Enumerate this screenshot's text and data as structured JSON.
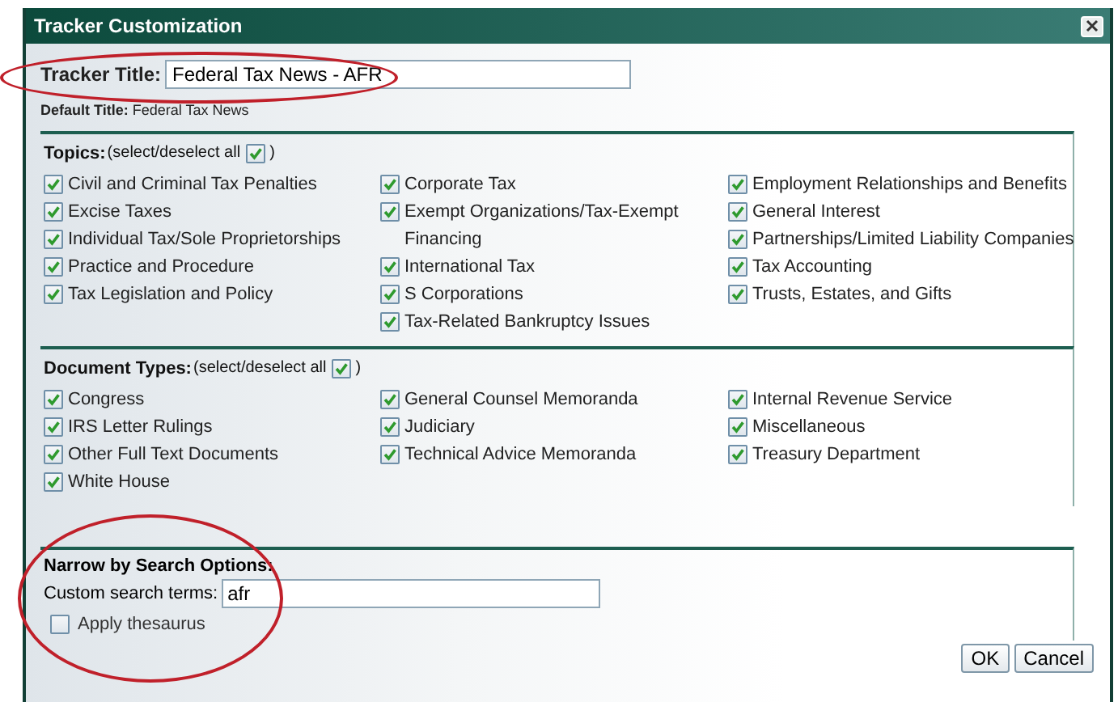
{
  "window": {
    "title": "Tracker Customization"
  },
  "tracker_title": {
    "label": "Tracker Title:",
    "value": "Federal Tax News - AFR",
    "highlighted": true
  },
  "default_title": {
    "label": "Default Title:",
    "value": "Federal Tax News"
  },
  "topics": {
    "label": "Topics:",
    "select_all_label": "(select/deselect all",
    "select_all_end": ")",
    "select_all_checked": true,
    "columns": [
      [
        {
          "label": "Civil and Criminal Tax Penalties",
          "checked": true
        },
        {
          "label": "Excise Taxes",
          "checked": true
        },
        {
          "label": "Individual Tax/Sole Proprietorships",
          "checked": true
        },
        {
          "label": "Practice and Procedure",
          "checked": true
        },
        {
          "label": "Tax Legislation and Policy",
          "checked": true
        }
      ],
      [
        {
          "label": "Corporate Tax",
          "checked": true
        },
        {
          "label": "Exempt Organizations/Tax-Exempt Financing",
          "checked": true
        },
        {
          "label": "International Tax",
          "checked": true
        },
        {
          "label": "S Corporations",
          "checked": true
        },
        {
          "label": "Tax-Related Bankruptcy Issues",
          "checked": true
        }
      ],
      [
        {
          "label": "Employment Relationships and Benefits",
          "checked": true
        },
        {
          "label": "General Interest",
          "checked": true
        },
        {
          "label": "Partnerships/Limited Liability Companies",
          "checked": true
        },
        {
          "label": "Tax Accounting",
          "checked": true
        },
        {
          "label": "Trusts, Estates, and Gifts",
          "checked": true
        }
      ]
    ]
  },
  "document_types": {
    "label": "Document Types:",
    "select_all_label": "(select/deselect all",
    "select_all_end": ")",
    "select_all_checked": true,
    "columns": [
      [
        {
          "label": "Congress",
          "checked": true
        },
        {
          "label": "IRS Letter Rulings",
          "checked": true
        },
        {
          "label": "Other Full Text Documents",
          "checked": true
        },
        {
          "label": "White House",
          "checked": true
        }
      ],
      [
        {
          "label": "General Counsel Memoranda",
          "checked": true
        },
        {
          "label": "Judiciary",
          "checked": true
        },
        {
          "label": "Technical Advice Memoranda",
          "checked": true
        }
      ],
      [
        {
          "label": "Internal Revenue Service",
          "checked": true
        },
        {
          "label": "Miscellaneous",
          "checked": true
        },
        {
          "label": "Treasury Department",
          "checked": true
        }
      ]
    ]
  },
  "search_options": {
    "heading": "Narrow by Search Options:",
    "terms_label": "Custom search terms:",
    "terms_value": "afr",
    "thesaurus": {
      "label": "Apply thesaurus",
      "checked": false
    },
    "highlighted": true
  },
  "buttons": [
    "OK",
    "Cancel"
  ]
}
